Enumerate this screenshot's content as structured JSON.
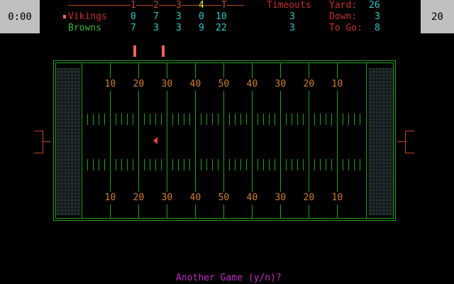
{
  "clock": {
    "left": "0:00",
    "right": "20"
  },
  "quarter_header": {
    "q1": "1",
    "q2": "2",
    "q3": "3",
    "q4": "4",
    "total": "T",
    "active_quarter": 4
  },
  "teams": [
    {
      "name": "Vikings",
      "q1": "0",
      "q2": "7",
      "q3": "3",
      "q4": "0",
      "total": "10",
      "timeouts": "3",
      "has_ball": false
    },
    {
      "name": "Browns",
      "q1": "7",
      "q2": "3",
      "q3": "3",
      "q4": "9",
      "total": "22",
      "timeouts": "3",
      "has_ball": true
    }
  ],
  "labels": {
    "timeouts": "Timeouts",
    "yard": "Yard:",
    "down": "Down:",
    "to_go": "To Go:"
  },
  "game_state": {
    "yard": "26",
    "down": "3",
    "to_go": "8"
  },
  "yard_numbers": [
    "10",
    "20",
    "30",
    "40",
    "50",
    "40",
    "30",
    "20",
    "10"
  ],
  "prompt": "Another Game (y/n)?",
  "colors": {
    "field_line": "#22a022",
    "goalpost": "#b84a2e",
    "marker": "#ff6060",
    "endzone_dots": "#6a8a8a",
    "ball": "#ff4040"
  }
}
